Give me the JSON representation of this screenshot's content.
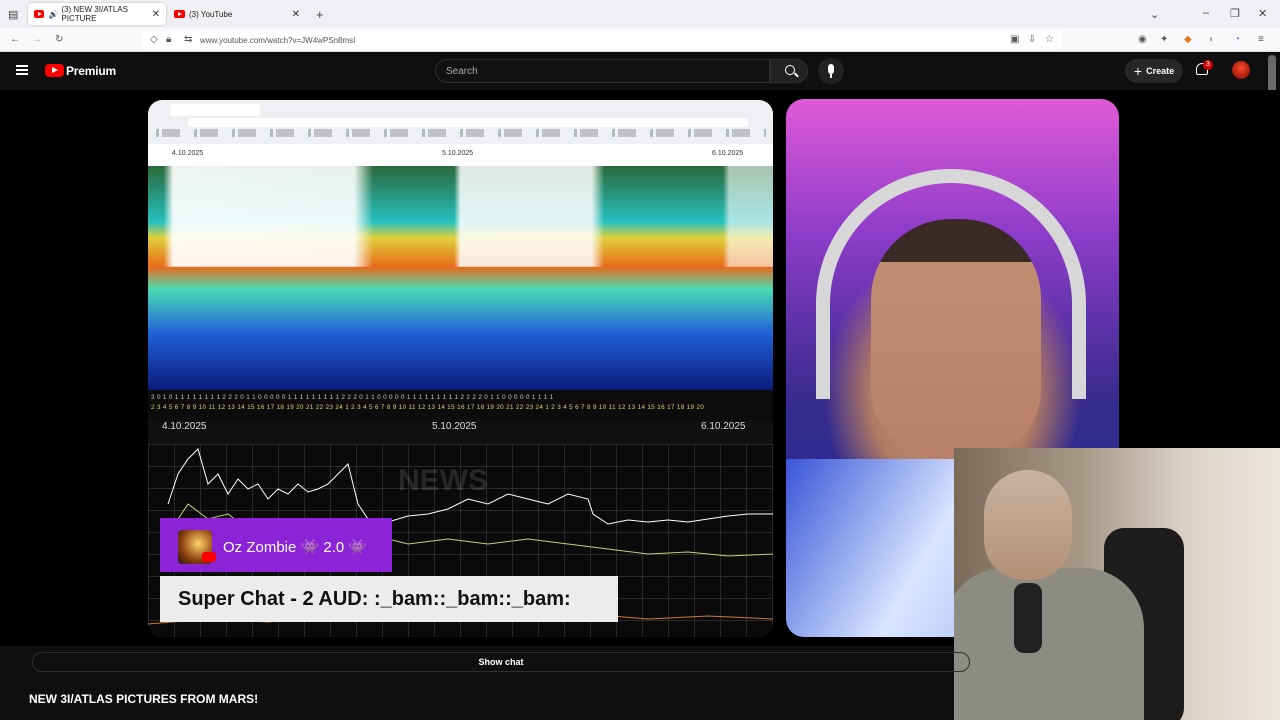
{
  "browser": {
    "tabs": [
      {
        "label": "(3) NEW 3I/ATLAS PICTURE",
        "active": true
      },
      {
        "label": "(3) YouTube",
        "active": false
      }
    ],
    "url": "www.youtube.com/watch?v=JW4wPSn8msI"
  },
  "youtube": {
    "logo_label": "Premium",
    "search_placeholder": "Search",
    "create_label": "Create",
    "notification_count": "3"
  },
  "video": {
    "spectrogram": {
      "dates_top": [
        "4.10.2025",
        "5.10.2025",
        "6.10.2025"
      ],
      "hour_row_1": "3 0 1 0 1 1 1 1 1 1 1 1 2 2 2 0 1 1 0 0 0 0 0 1 1 1 1 1 1 1 1 1 2 2 2 0 1 1 0 0 0 0 0 1 1 1 1 1 1 1 1 1 2 2 2 2 0 1 1 0 0 0 0 0 1 1 1 1",
      "hour_row_2": "2 3 4 5 6 7 8 9 10 11 12 13 14 15 16 17 18 19 20 21 22 23 24 1 2 3 4 5 6 7 8 9 10 11 12 13 14 15 16 17 18 19 20 21 22 23 24 1 2 3 4 5 6 7 8 9 10 11 12 13 14 15 16 17 18 19 20",
      "dates_bottom": [
        "4.10.2025",
        "5.10.2025",
        "6.10.2025"
      ],
      "watermark": "NEWS"
    },
    "super_chat": {
      "name": "Oz Zombie 👾 2.0 👾",
      "message": "Super Chat - 2 AUD: :_bam::_bam::_bam:"
    }
  },
  "below": {
    "show_chat_label": "Show chat",
    "video_title": "NEW 3I/ATLAS PICTURES FROM MARS!"
  }
}
